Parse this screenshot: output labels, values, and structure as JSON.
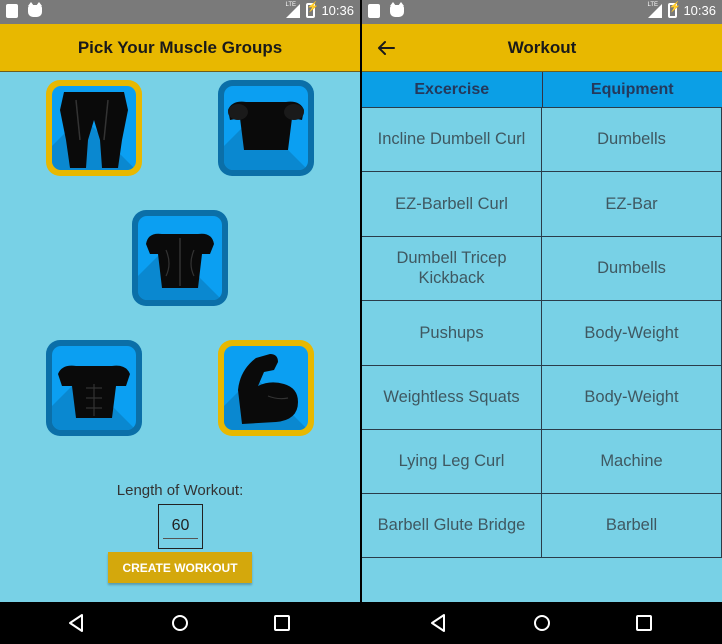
{
  "status_bar": {
    "time": "10:36",
    "network": "LTE"
  },
  "left_screen": {
    "title": "Pick Your Muscle Groups",
    "muscle_groups": [
      {
        "name": "legs",
        "selected": true
      },
      {
        "name": "shoulders",
        "selected": false
      },
      {
        "name": "back",
        "selected": false
      },
      {
        "name": "abs",
        "selected": false
      },
      {
        "name": "arms",
        "selected": true
      }
    ],
    "length_label": "Length of Workout:",
    "length_value": "60",
    "create_button": "CREATE WORKOUT"
  },
  "right_screen": {
    "title": "Workout",
    "table": {
      "headers": [
        "Excercise",
        "Equipment"
      ],
      "rows": [
        [
          "Incline Dumbell Curl",
          "Dumbells"
        ],
        [
          "EZ-Barbell Curl",
          "EZ-Bar"
        ],
        [
          "Dumbell Tricep Kickback",
          "Dumbells"
        ],
        [
          "Pushups",
          "Body-Weight"
        ],
        [
          "Weightless Squats",
          "Body-Weight"
        ],
        [
          "Lying Leg Curl",
          "Machine"
        ],
        [
          "Barbell Glute Bridge",
          "Barbell"
        ]
      ]
    }
  },
  "nav_icons": [
    "back-triangle-icon",
    "home-circle-icon",
    "recents-square-icon"
  ],
  "colors": {
    "appbar": "#e8b800",
    "background": "#78d1e6",
    "tile_blue": "#0b9ff2",
    "tile_selected_border": "#e8b800",
    "table_header": "#0b9fe6",
    "button": "#d4a80c"
  }
}
